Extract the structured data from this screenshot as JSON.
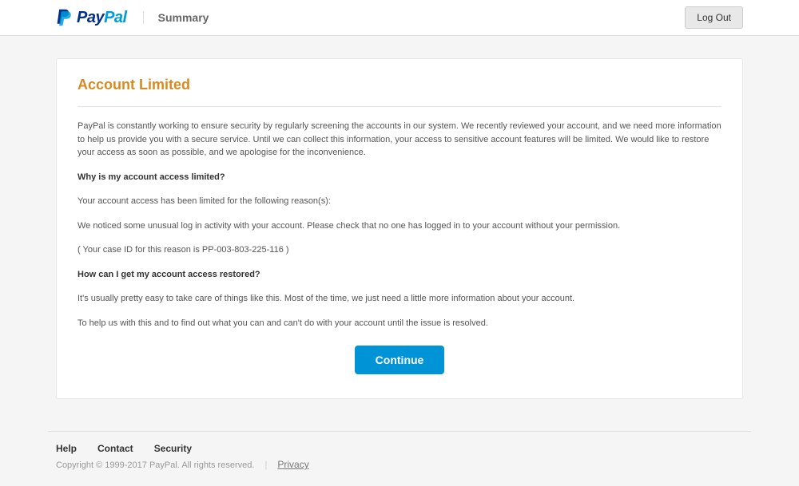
{
  "header": {
    "logo_pay": "Pay",
    "logo_pal": "Pal",
    "nav_summary": "Summary",
    "logout": "Log Out"
  },
  "card": {
    "title": "Account Limited",
    "intro": "PayPal is constantly working to ensure security by regularly screening the accounts in our system. We recently reviewed your account, and we need more information to help us provide you with a secure service. Until we can collect this information, your access to sensitive account features will be limited. We would like to restore your access as soon as possible, and we apologise for the inconvenience.",
    "q1": "Why is my account access limited?",
    "p1": "Your account access has been limited for the following reason(s):",
    "p2": "We noticed some unusual log in activity with your account. Please check that no one has logged in to your account without your permission.",
    "p3": "( Your case ID for this reason is PP-003-803-225-116 )",
    "q2": "How can I get my account access restored?",
    "p4": "It's usually pretty easy to take care of things like this. Most of the time, we just need a little more information about your account.",
    "p5": "To help us with this and to find out what you can and can't do with your account until the issue is resolved.",
    "continue": "Continue"
  },
  "footer": {
    "help": "Help",
    "contact": "Contact",
    "security": "Security",
    "copyright": "Copyright © 1999-2017 PayPal. All rights reserved.",
    "sep": "|",
    "privacy": "Privacy"
  }
}
